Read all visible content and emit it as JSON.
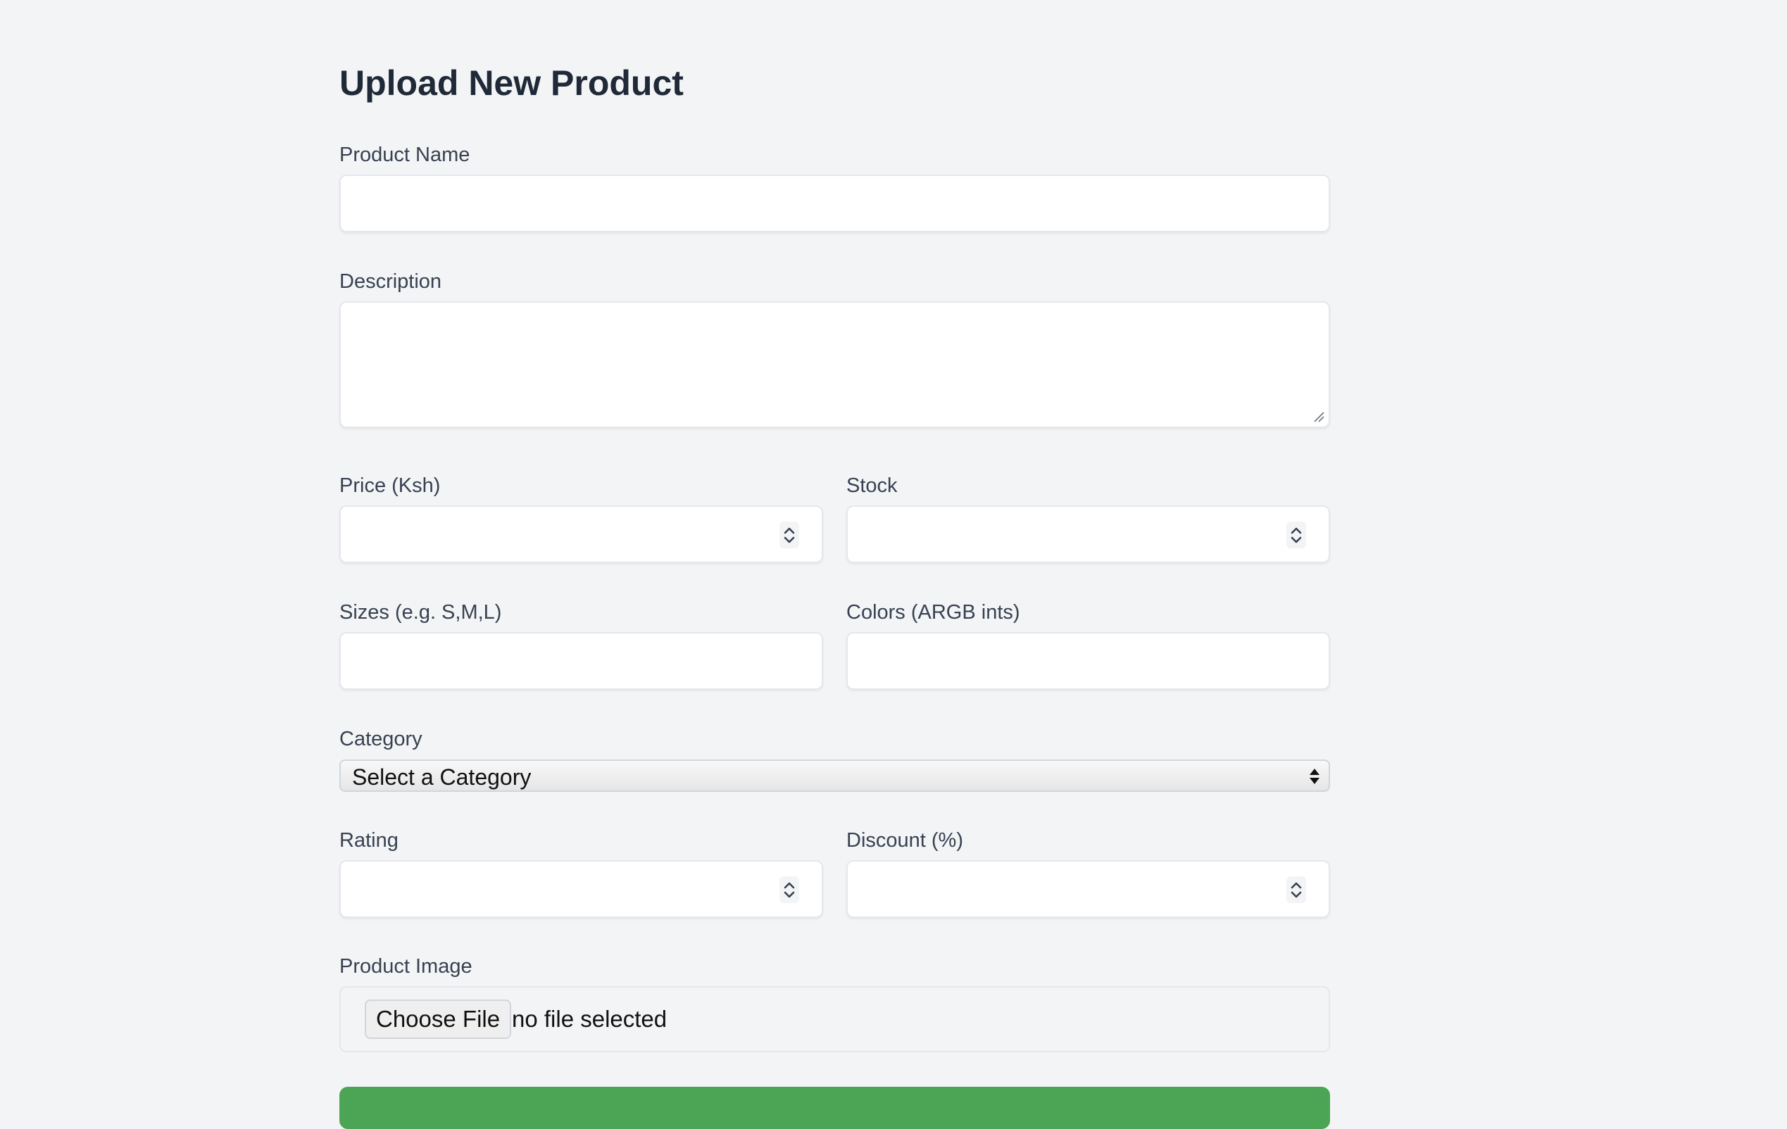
{
  "form": {
    "title": "Upload New Product",
    "product_name": {
      "label": "Product Name",
      "value": ""
    },
    "description": {
      "label": "Description",
      "value": ""
    },
    "price": {
      "label": "Price (Ksh)",
      "value": ""
    },
    "stock": {
      "label": "Stock",
      "value": ""
    },
    "sizes": {
      "label": "Sizes (e.g. S,M,L)",
      "value": ""
    },
    "colors": {
      "label": "Colors (ARGB ints)",
      "value": ""
    },
    "category": {
      "label": "Category",
      "selected": "Select a Category"
    },
    "rating": {
      "label": "Rating",
      "value": ""
    },
    "discount": {
      "label": "Discount (%)",
      "value": ""
    },
    "image": {
      "label": "Product Image",
      "button_label": "Choose File",
      "status": "no file selected"
    }
  },
  "theme": {
    "background": "#f3f4f6",
    "submit_color": "#4ca455",
    "text_color": "#1f2937"
  }
}
